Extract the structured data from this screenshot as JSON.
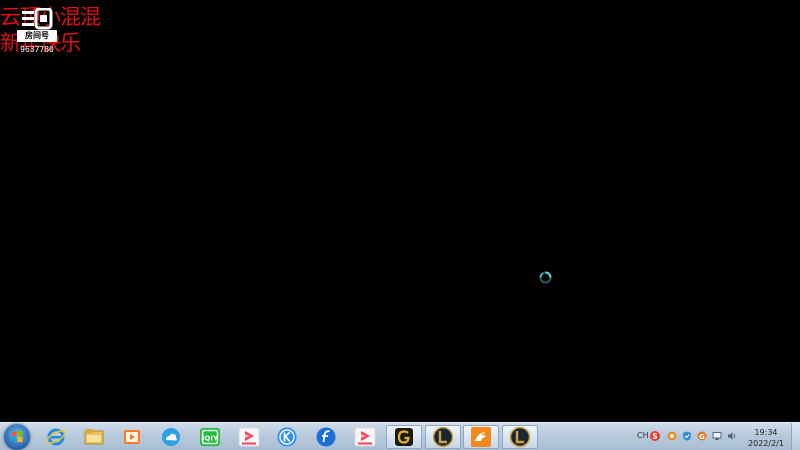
{
  "overlay": {
    "line1": "云顶小混混",
    "line2": "新年快乐",
    "logo_text": "斗鱼",
    "logo_box": "房间号",
    "room_id": "9637780"
  },
  "taskbar": {
    "start_icon": "windows-orb-icon",
    "apps": [
      {
        "name": "internet-explorer-icon",
        "color": "#1e8ee0"
      },
      {
        "name": "file-explorer-icon",
        "color": "#e9c35a"
      },
      {
        "name": "media-player-icon",
        "color": "#ff7a1a"
      },
      {
        "name": "weather-cloud-icon",
        "color": "#2aa0e6"
      },
      {
        "name": "iqiyi-icon",
        "color": "#1fbf3a"
      },
      {
        "name": "tencent-video-icon",
        "color": "#ff3c55"
      },
      {
        "name": "kugou-icon",
        "color": "#2b8ef0"
      },
      {
        "name": "flash-icon",
        "color": "#1d6fd8"
      },
      {
        "name": "tencent-video-2-icon",
        "color": "#ff3c55"
      },
      {
        "name": "g-app-icon",
        "color": "#e5b21a"
      },
      {
        "name": "league-client-icon",
        "color": "#c9a24a"
      },
      {
        "name": "bird-app-icon",
        "color": "#f08a1c"
      },
      {
        "name": "league-game-icon",
        "color": "#c9a24a"
      }
    ],
    "tray": {
      "language": "CH",
      "time": "19:34",
      "date": "2022/2/1"
    }
  }
}
